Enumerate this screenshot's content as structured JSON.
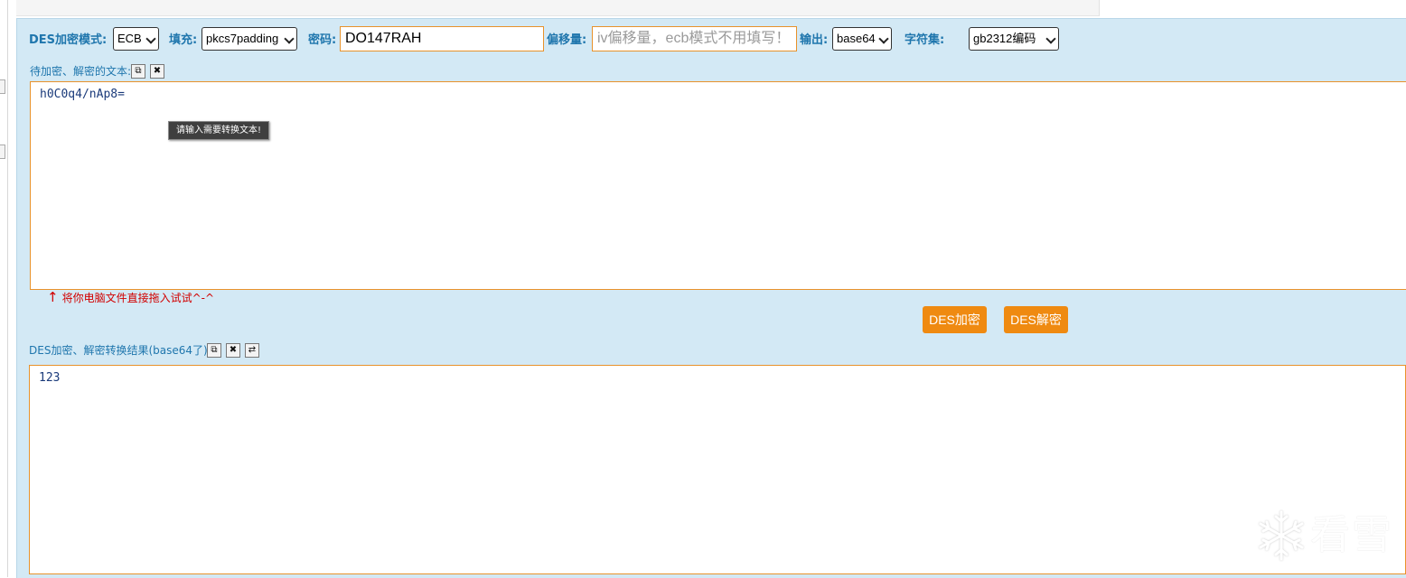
{
  "toolbar": {
    "mode_label": "DES加密模式:",
    "mode_value": "ECB",
    "padding_label": "填充:",
    "padding_value": "pkcs7padding",
    "key_label": "密码:",
    "key_value": "DO147RAH",
    "iv_label": "偏移量:",
    "iv_placeholder": "iv偏移量，ecb模式不用填写！",
    "output_label": "输出:",
    "output_value": "base64",
    "charset_label": "字符集:",
    "charset_value": "gb2312编码"
  },
  "input_section": {
    "label": "待加密、解密的文本:",
    "copy_icon": "copy-icon",
    "clear_icon": "close-icon",
    "text": "h0C0q4/nAp8=",
    "tooltip": "请输入需要转换文本!",
    "drag_hint": "将你电脑文件直接拖入试试^-^",
    "arrow": "↑"
  },
  "actions": {
    "encrypt": "DES加密",
    "decrypt": "DES解密"
  },
  "output_section": {
    "label": "DES加密、解密转换结果(base64了):",
    "text": "123"
  },
  "watermark": {
    "text": "看雪"
  },
  "colors": {
    "panel_bg": "#d3e9f5",
    "label_blue": "#1f76ad",
    "accent_orange": "#ef8a11",
    "hint_red": "#d20000"
  }
}
